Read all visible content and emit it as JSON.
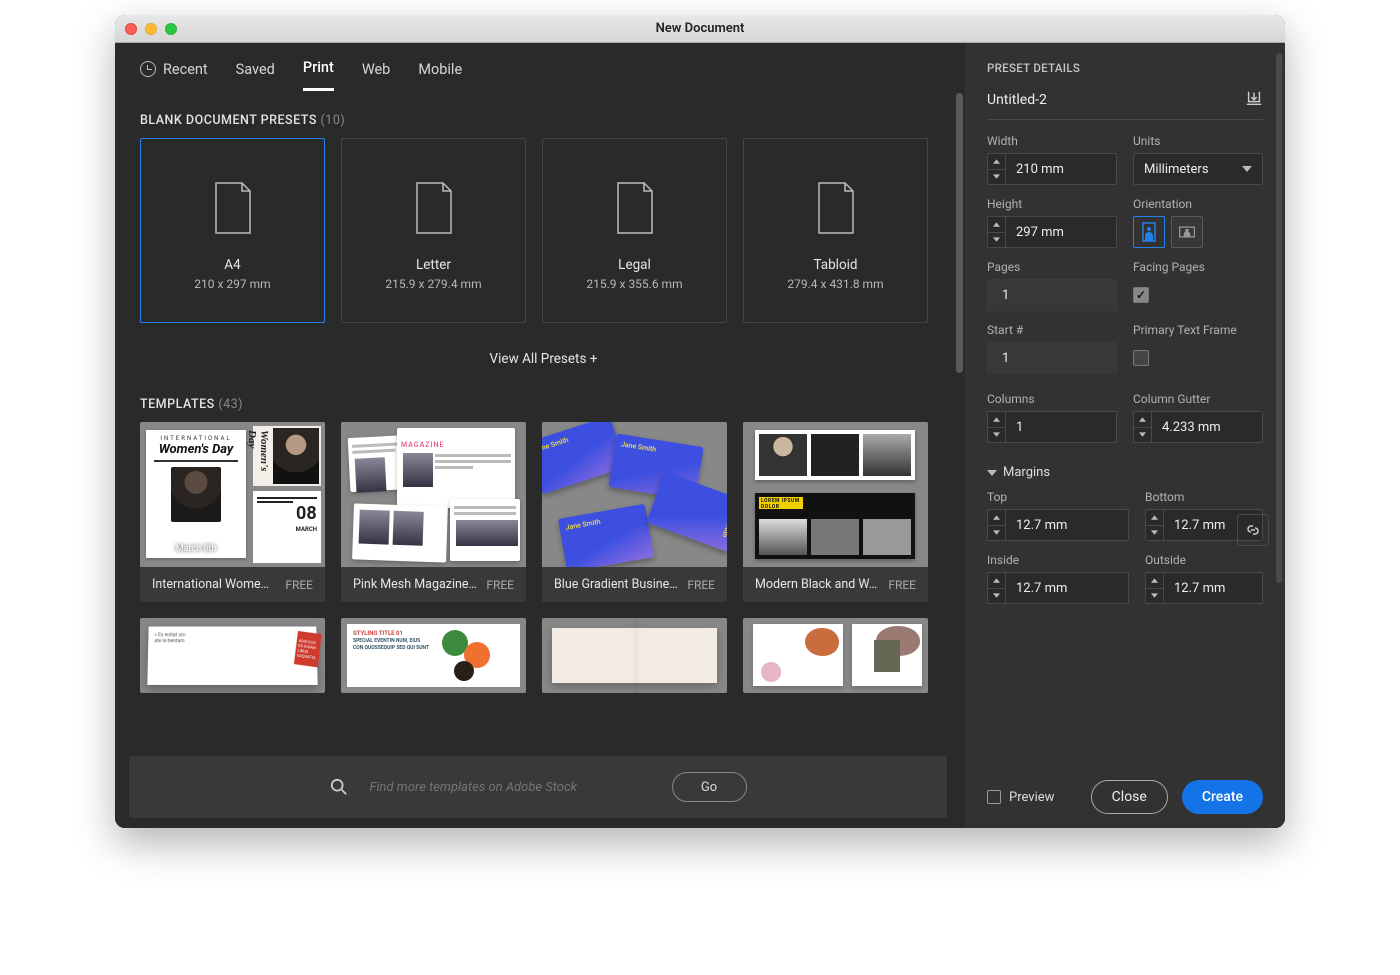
{
  "window": {
    "title": "New Document"
  },
  "tabs": {
    "recent": "Recent",
    "saved": "Saved",
    "print": "Print",
    "web": "Web",
    "mobile": "Mobile"
  },
  "presets_section": {
    "title": "BLANK DOCUMENT PRESETS",
    "count": "(10)"
  },
  "presets": [
    {
      "name": "A4",
      "dims": "210 x 297 mm"
    },
    {
      "name": "Letter",
      "dims": "215.9 x 279.4 mm"
    },
    {
      "name": "Legal",
      "dims": "215.9 x 355.6 mm"
    },
    {
      "name": "Tabloid",
      "dims": "279.4 x 431.8 mm"
    }
  ],
  "view_all": "View All Presets +",
  "templates_section": {
    "title": "TEMPLATES",
    "count": "(43)"
  },
  "templates": [
    {
      "name": "International Wome…",
      "price": "FREE"
    },
    {
      "name": "Pink Mesh Magazine…",
      "price": "FREE"
    },
    {
      "name": "Blue Gradient Busine…",
      "price": "FREE"
    },
    {
      "name": "Modern Black and W…",
      "price": "FREE"
    }
  ],
  "search": {
    "placeholder": "Find more templates on Adobe Stock",
    "go": "Go"
  },
  "details": {
    "heading": "PRESET DETAILS",
    "doc_name": "Untitled-2",
    "width_label": "Width",
    "width_value": "210 mm",
    "units_label": "Units",
    "units_value": "Millimeters",
    "height_label": "Height",
    "height_value": "297 mm",
    "orientation_label": "Orientation",
    "pages_label": "Pages",
    "pages_value": "1",
    "facing_label": "Facing Pages",
    "start_label": "Start #",
    "start_value": "1",
    "primary_label": "Primary Text Frame",
    "columns_label": "Columns",
    "columns_value": "1",
    "gutter_label": "Column Gutter",
    "gutter_value": "4.233 mm",
    "margins_label": "Margins",
    "top_label": "Top",
    "top_value": "12.7 mm",
    "bottom_label": "Bottom",
    "bottom_value": "12.7 mm",
    "inside_label": "Inside",
    "inside_value": "12.7 mm",
    "outside_label": "Outside",
    "outside_value": "12.7 mm"
  },
  "footer": {
    "preview": "Preview",
    "close": "Close",
    "create": "Create"
  },
  "art": {
    "international": "INTERNATIONAL",
    "womens_day": "Women's Day",
    "march": "March 8th",
    "date08": "08",
    "dateword": "MARCH",
    "magazine": "MAGAZINE",
    "jane": "Jane Smith",
    "lorem": "LOREM IPSUM DOLOR",
    "styling": "STYLING TITLE 01",
    "event": "SPECIAL EVENTIN NUM, EIUS CON QUOSSEQUIP SED QUI SUNT",
    "adis": "ADIS EOS ES IUSAM LIBUS EAQUATIA"
  }
}
